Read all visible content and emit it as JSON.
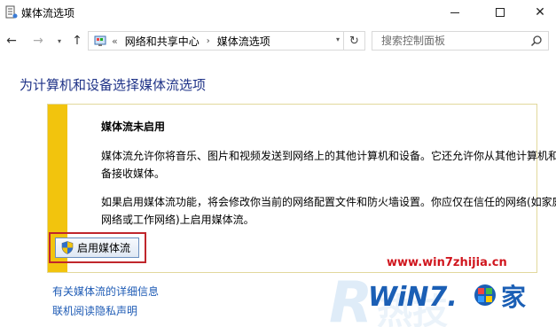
{
  "window": {
    "title": "媒体流选项",
    "minimize_label": "—",
    "maximize_label": "□",
    "close_label": "✕"
  },
  "nav": {
    "back_glyph": "←",
    "forward_glyph": "→",
    "history_glyph": "▾",
    "up_glyph": "↑",
    "breadcrumb_prefix": "«",
    "breadcrumbs": [
      "网络和共享中心",
      "媒体流选项"
    ],
    "crumb_separator": "›",
    "address_dropdown_glyph": "▾",
    "refresh_glyph": "↻",
    "search_placeholder": "搜索控制面板"
  },
  "main": {
    "title": "为计算机和设备选择媒体流选项",
    "notice": {
      "heading": "媒体流未启用",
      "paragraph1": "媒体流允许你将音乐、图片和视频发送到网络上的其他计算机和设备。它还允许你从其他计算机和设备接收媒体。",
      "paragraph2": "如果启用媒体流功能，将会修改你当前的网络配置文件和防火墙设置。你应仅在信任的网络(如家庭网络或工作网络)上启用媒体流。",
      "button_label": "启用媒体流"
    },
    "links": [
      "有关媒体流的详细信息",
      "联机阅读隐私声明"
    ]
  },
  "watermark": {
    "url": "www.win7zhijia.cn"
  },
  "colors": {
    "title_blue": "#1e3287",
    "link_blue": "#1e5bb5",
    "notice_accent": "#f2c40d",
    "highlight_red": "#c0262c"
  },
  "icons": {
    "title_icon": "media-stream-icon",
    "address_icon": "control-panel-icon",
    "search_icon": "magnifier-icon",
    "button_icon": "uac-shield-icon"
  }
}
